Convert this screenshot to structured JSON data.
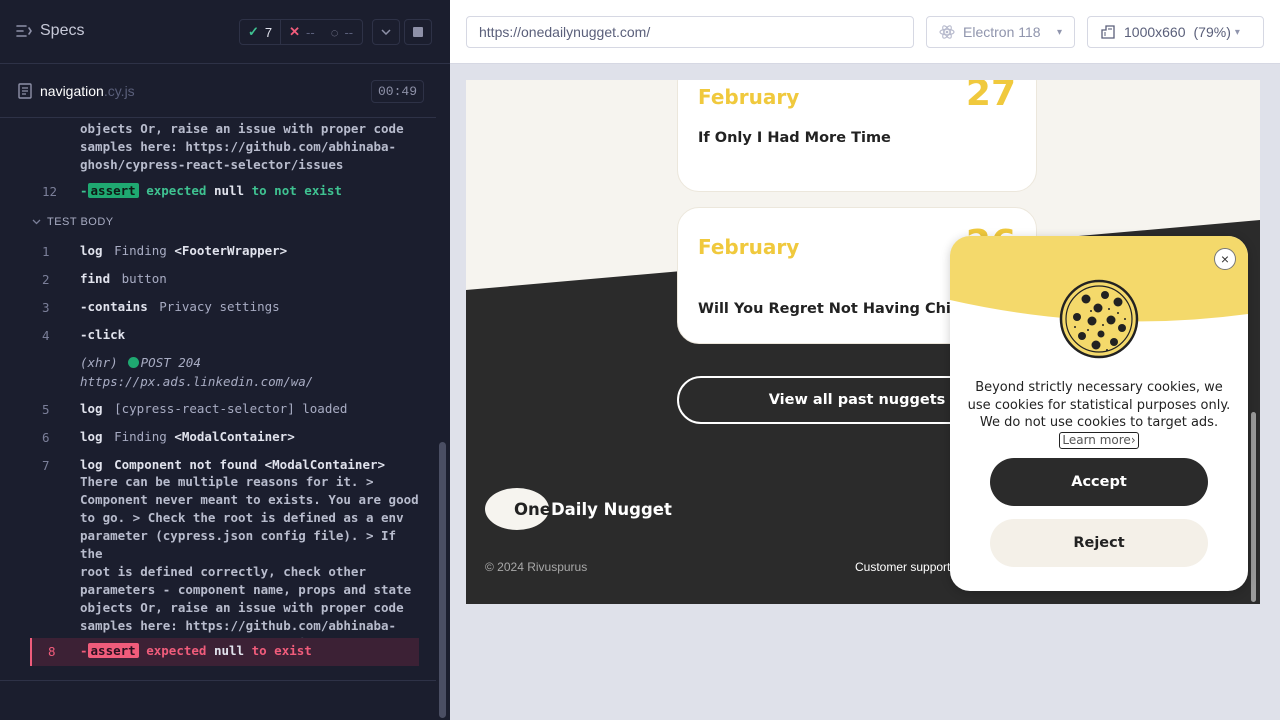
{
  "runner": {
    "specs_title": "Specs",
    "stats": {
      "passed": "7",
      "failed": "--",
      "pending": "--"
    },
    "spec": {
      "name": "navigation",
      "ext": ".cy.js",
      "time": "00:49"
    },
    "log": {
      "prev_tail": "objects Or, raise an issue with proper code\nsamples here: https://github.com/abhinaba-\nghosh/cypress-react-selector/issues",
      "prev_assert": {
        "num": "12",
        "prefix": "-",
        "tag": "assert",
        "w1": "expected",
        "w2": "null",
        "w3": "to not exist"
      },
      "section": "TEST BODY",
      "rows": [
        {
          "num": "1",
          "cmd": "log",
          "arg": "Finding",
          "argw": "<FooterWrapper>"
        },
        {
          "num": "2",
          "cmd": "find",
          "arg": "button",
          "argw": ""
        },
        {
          "num": "3",
          "cmd": "-contains",
          "arg": "Privacy settings",
          "argw": ""
        },
        {
          "num": "4",
          "cmd": "-click",
          "arg": "",
          "argw": ""
        },
        {
          "num": "5",
          "cmd": "log",
          "arg": "[cypress-react-selector] loaded",
          "argw": ""
        },
        {
          "num": "6",
          "cmd": "log",
          "arg": "Finding",
          "argw": "<ModalContainer>"
        },
        {
          "num": "7",
          "cmd": "log",
          "arg": "",
          "argw": "Component not found <ModalContainer>"
        }
      ],
      "xhr": {
        "label": "(xhr)",
        "method": "POST 204",
        "url": "https://px.ads.linkedin.com/wa/"
      },
      "row7_detail": "There can be multiple reasons for it. >\nComponent never meant to exists. You are good\nto go. > Check the root is defined as a env\nparameter (cypress.json config file). > If the\nroot is defined correctly, check other\nparameters - component name, props and state\nobjects Or, raise an issue with proper code\nsamples here: https://github.com/abhinaba-\nghosh/cypress-react-selector/issues",
      "fail": {
        "num": "8",
        "prefix": "-",
        "tag": "assert",
        "w1": "expected",
        "w2": "null",
        "w3": "to exist"
      }
    }
  },
  "browser": {
    "url": "https://onedailynugget.com/",
    "browser_name": "Electron 118",
    "viewport": "1000x660",
    "scale": "(79%)"
  },
  "site": {
    "cards": [
      {
        "month": "February",
        "day": "27",
        "headline": "If Only I Had More Time"
      },
      {
        "month": "February",
        "day": "26",
        "headline": "Will You Regret Not Having Children?"
      }
    ],
    "past_button": "View all past nuggets",
    "logo_one": "One",
    "logo_rest": "Daily Nugget",
    "copyright": "© 2024 Rivuspurus",
    "support": "Customer support",
    "cookie": {
      "text": "Beyond strictly necessary cookies, we use cookies for statistical purposes only. We do not use cookies to target ads.",
      "learn_more": "Learn more›",
      "accept": "Accept",
      "reject": "Reject",
      "close": "×"
    }
  },
  "colors": {
    "accent_yellow": "#f0c93d",
    "dark": "#2b2b2b",
    "pass": "#3fc291",
    "fail": "#f05c7b"
  }
}
